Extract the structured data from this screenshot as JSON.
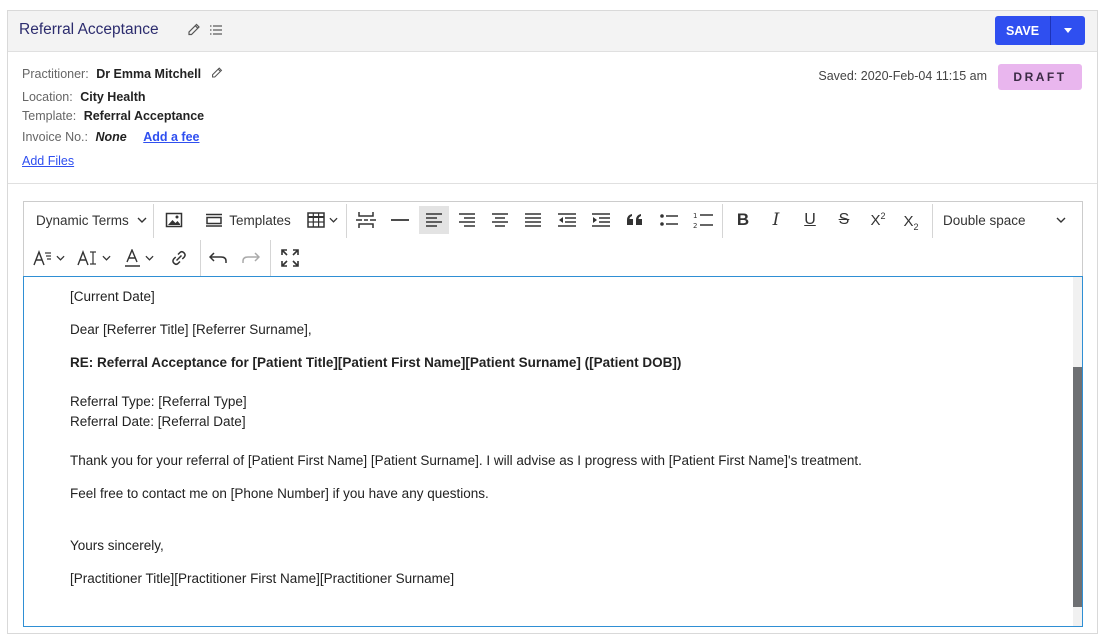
{
  "header": {
    "title": "Referral Acceptance",
    "save_label": "SAVE"
  },
  "info": {
    "practitioner_label": "Practitioner:",
    "practitioner_value": "Dr Emma Mitchell",
    "location_label": "Location:",
    "location_value": "City Health",
    "template_label": "Template:",
    "template_value": "Referral Acceptance",
    "invoice_label": "Invoice No.:",
    "invoice_value": "None",
    "add_fee": "Add a fee",
    "add_files": "Add Files",
    "saved_text": "Saved: 2020-Feb-04 11:15 am",
    "status_badge": "DRAFT"
  },
  "toolbar": {
    "dynamic_terms": "Dynamic Terms",
    "templates": "Templates",
    "line_spacing": "Double space"
  },
  "document": {
    "line1": "[Current Date]",
    "line2": "Dear [Referrer Title] [Referrer Surname],",
    "line3": "RE: Referral Acceptance for [Patient Title][Patient First Name][Patient Surname] ([Patient DOB])",
    "line4": "Referral Type: [Referral Type]",
    "line5": "Referral Date: [Referral Date]",
    "line6": "Thank you for your referral of [Patient First Name] [Patient Surname]. I will advise as I progress with [Patient First Name]'s treatment.",
    "line7": "Feel free to contact me on [Phone Number] if you have any questions.",
    "line8": "Yours sincerely,",
    "line9": "[Practitioner Title][Practitioner First Name][Practitioner Surname]"
  },
  "colors": {
    "primary": "#2f4ff0",
    "draft_badge": "#e9b6ee",
    "title": "#2c2c6e"
  }
}
